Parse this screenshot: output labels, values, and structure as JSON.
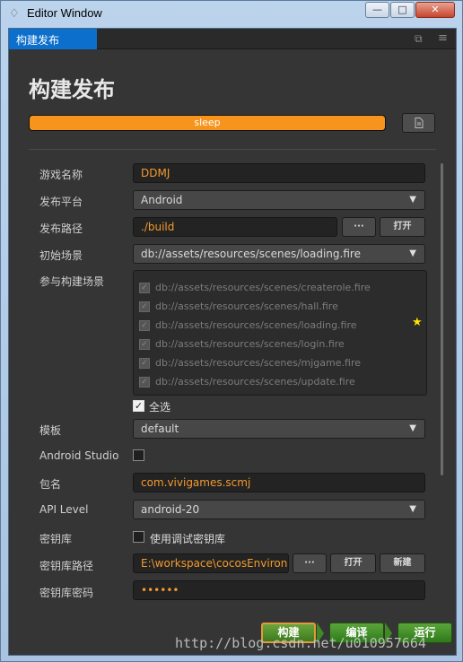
{
  "window": {
    "title": "Editor Window",
    "minimize": "—",
    "maximize": "□",
    "close": "✕"
  },
  "tab": {
    "label": "构建发布",
    "popout": "⧉",
    "menu": "≡"
  },
  "page": {
    "title": "构建发布"
  },
  "progress": {
    "label": "sleep",
    "value": 1.0,
    "log_icon": "📄"
  },
  "form": {
    "game_name": {
      "label": "游戏名称",
      "value": "DDMJ"
    },
    "platform": {
      "label": "发布平台",
      "value": "Android"
    },
    "build_path": {
      "label": "发布路径",
      "value": "./build",
      "browse": "···",
      "open": "打开"
    },
    "start_scene": {
      "label": "初始场景",
      "value": "db://assets/resources/scenes/loading.fire"
    },
    "scenes": {
      "label": "参与构建场景",
      "items": [
        "db://assets/resources/scenes/createrole.fire",
        "db://assets/resources/scenes/hall.fire",
        "db://assets/resources/scenes/loading.fire",
        "db://assets/resources/scenes/login.fire",
        "db://assets/resources/scenes/mjgame.fire",
        "db://assets/resources/scenes/update.fire"
      ],
      "select_all": "全选"
    },
    "template": {
      "label": "模板",
      "value": "default"
    },
    "android_studio": {
      "label": "Android Studio"
    },
    "package": {
      "label": "包名",
      "value": "com.vivigames.scmj"
    },
    "api_level": {
      "label": "API Level",
      "value": "android-20"
    },
    "keystore": {
      "label": "密钥库",
      "option": "使用调试密钥库"
    },
    "keystore_path": {
      "label": "密钥库路径",
      "value": "E:\\workspace\\cocosEnvironme",
      "browse": "···",
      "open": "打开",
      "new": "新建"
    },
    "keystore_password": {
      "label": "密钥库密码",
      "value": "••••••"
    }
  },
  "footer": {
    "build": "构建",
    "compile": "编译",
    "run": "运行"
  },
  "watermark": "http://blog.csdn.net/u010957664",
  "colors": {
    "accent": "#f7941d",
    "tab": "#0d6fcc",
    "panel": "#353535"
  }
}
